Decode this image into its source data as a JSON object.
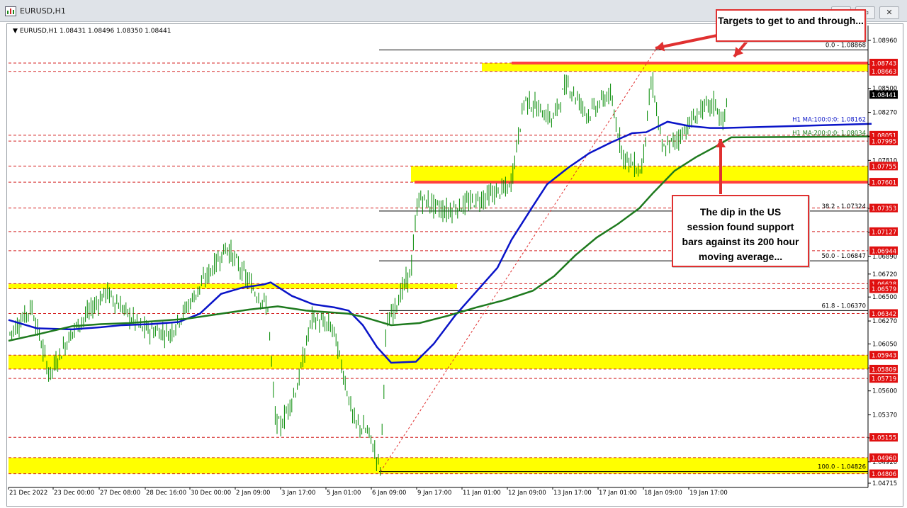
{
  "window": {
    "title": "EURUSD,H1",
    "controls": [
      "–",
      "▭",
      "✕"
    ]
  },
  "chart_header": {
    "marker": "▼",
    "text": "EURUSD,H1  1.08431 1.08496 1.08350 1.08441"
  },
  "annotations": {
    "targets": "Targets to get to and through...",
    "dip": "The dip in the US session found support bars against its 200 hour moving average..."
  },
  "colors": {
    "ma100": "#0a14c8",
    "ma200": "#1e7a1e",
    "support_zone": "#ffff00",
    "resistance_line": "#ff4040",
    "level_line": "#d42020",
    "price_tag": "#e01010",
    "current_price_tag": "#000000",
    "candles": "#008800"
  },
  "icons": {
    "app": "chart-window-icon"
  },
  "chart_data": {
    "type": "candlestick",
    "symbol": "EURUSD",
    "timeframe": "H1",
    "ohlc_last": {
      "open": 1.08431,
      "high": 1.08496,
      "low": 1.0835,
      "close": 1.08441
    },
    "ylim": [
      1.04715,
      1.0896
    ],
    "y_ticks": [
      "1.08960",
      "1.08730",
      "1.08500",
      "1.08270",
      "1.08040",
      "1.07810",
      "1.07580",
      "1.07350",
      "1.07120",
      "1.06890",
      "1.06720",
      "1.06500",
      "1.06270",
      "1.06050",
      "1.05820",
      "1.05600",
      "1.05370",
      "1.05150",
      "1.04920",
      "1.04715"
    ],
    "x_labels": [
      "21 Dec 2022",
      "23 Dec 00:00",
      "27 Dec 08:00",
      "28 Dec 16:00",
      "30 Dec 00:00",
      "2 Jan 09:00",
      "3 Jan 17:00",
      "5 Jan 01:00",
      "6 Jan 09:00",
      "9 Jan 17:00",
      "11 Jan 01:00",
      "12 Jan 09:00",
      "13 Jan 17:00",
      "17 Jan 01:00",
      "18 Jan 09:00",
      "19 Jan 17:00"
    ],
    "current_price": "1.08441",
    "price_tags": [
      "1.08743",
      "1.08663",
      "1.08051",
      "1.07995",
      "1.07755",
      "1.07601",
      "1.07353",
      "1.07127",
      "1.06944",
      "1.06628",
      "1.06579",
      "1.06342",
      "1.05943",
      "1.05809",
      "1.05719",
      "1.05155",
      "1.04960",
      "1.04806"
    ],
    "support_zones": [
      [
        1.08663,
        1.08743
      ],
      [
        1.07601,
        1.07755
      ],
      [
        1.06579,
        1.06628
      ],
      [
        1.05809,
        1.05943
      ],
      [
        1.04806,
        1.0496
      ]
    ],
    "fibonacci": [
      {
        "level": "0.0",
        "price": 1.08868,
        "label": "0.0 - 1.08868"
      },
      {
        "level": "38.2",
        "price": 1.07324,
        "label": "38.2 - 1.07324"
      },
      {
        "level": "50.0",
        "price": 1.06847,
        "label": "50.0 - 1.06847"
      },
      {
        "level": "61.8",
        "price": 1.0637,
        "label": "61.8 - 1.06370"
      },
      {
        "level": "100.0",
        "price": 1.04826,
        "label": "100.0 - 1.04826"
      }
    ],
    "moving_averages": [
      {
        "name": "H1 MA:100:0:0: 1.08162",
        "period": 100,
        "value": 1.08162,
        "path": [
          [
            0,
            1.0628
          ],
          [
            40,
            1.062
          ],
          [
            90,
            1.0619
          ],
          [
            130,
            1.0621
          ],
          [
            160,
            1.0623
          ],
          [
            200,
            1.0624
          ],
          [
            240,
            1.0626
          ],
          [
            270,
            1.0634
          ],
          [
            300,
            1.0653
          ],
          [
            330,
            1.0659
          ],
          [
            360,
            1.0662
          ],
          [
            370,
            1.0664
          ],
          [
            400,
            1.0651
          ],
          [
            430,
            1.0643
          ],
          [
            460,
            1.064
          ],
          [
            480,
            1.0637
          ],
          [
            500,
            1.0623
          ],
          [
            520,
            1.0602
          ],
          [
            540,
            1.0587
          ],
          [
            575,
            1.0588
          ],
          [
            600,
            1.0605
          ],
          [
            630,
            1.0632
          ],
          [
            660,
            1.0655
          ],
          [
            690,
            1.0678
          ],
          [
            710,
            1.0705
          ],
          [
            740,
            1.0737
          ],
          [
            760,
            1.0758
          ],
          [
            790,
            1.0774
          ],
          [
            820,
            1.0788
          ],
          [
            850,
            1.0798
          ],
          [
            880,
            1.0807
          ],
          [
            900,
            1.0808
          ],
          [
            930,
            1.0818
          ],
          [
            960,
            1.0814
          ],
          [
            990,
            1.0812
          ],
          [
            1010,
            1.0812
          ],
          [
            1218,
            1.0816
          ]
        ]
      },
      {
        "name": "H1 MA:200:0:0: 1.08034",
        "period": 200,
        "value": 1.08034,
        "path": [
          [
            0,
            1.0608
          ],
          [
            40,
            1.0614
          ],
          [
            90,
            1.0622
          ],
          [
            130,
            1.0624
          ],
          [
            170,
            1.0625
          ],
          [
            210,
            1.0627
          ],
          [
            250,
            1.0629
          ],
          [
            300,
            1.0634
          ],
          [
            340,
            1.0638
          ],
          [
            380,
            1.0641
          ],
          [
            420,
            1.0637
          ],
          [
            460,
            1.0635
          ],
          [
            480,
            1.0634
          ],
          [
            500,
            1.0631
          ],
          [
            520,
            1.0627
          ],
          [
            540,
            1.0623
          ],
          [
            580,
            1.0625
          ],
          [
            620,
            1.0632
          ],
          [
            660,
            1.064
          ],
          [
            700,
            1.0647
          ],
          [
            740,
            1.0656
          ],
          [
            770,
            1.067
          ],
          [
            800,
            1.069
          ],
          [
            830,
            1.0707
          ],
          [
            860,
            1.072
          ],
          [
            890,
            1.0735
          ],
          [
            910,
            1.075
          ],
          [
            940,
            1.0771
          ],
          [
            970,
            1.0784
          ],
          [
            1000,
            1.0795
          ],
          [
            1020,
            1.0803
          ],
          [
            1218,
            1.0804
          ]
        ]
      }
    ],
    "grid": false
  }
}
